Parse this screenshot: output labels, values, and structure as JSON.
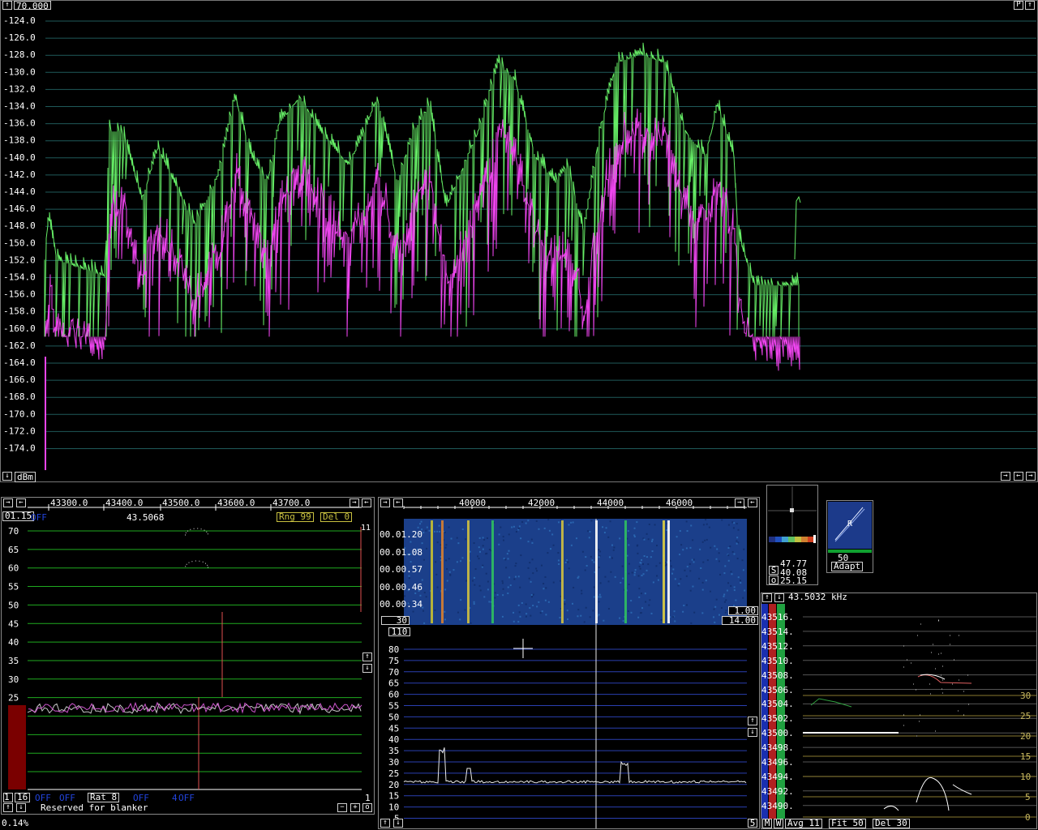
{
  "top_bar": {
    "frequency_field": "70.000",
    "p_button": "P"
  },
  "main_spectrum": {
    "unit_label": "dBm",
    "y_ticks": [
      "-124.0",
      "-126.0",
      "-128.0",
      "-130.0",
      "-132.0",
      "-134.0",
      "-136.0",
      "-138.0",
      "-140.0",
      "-142.0",
      "-144.0",
      "-146.0",
      "-148.0",
      "-150.0",
      "-152.0",
      "-154.0",
      "-156.0",
      "-158.0",
      "-160.0",
      "-162.0",
      "-164.0",
      "-166.0",
      "-168.0",
      "-170.0",
      "-172.0",
      "-174.0"
    ],
    "trace_colors": {
      "peak": "#66ee66",
      "average": "#ee44ee",
      "grid": "#1f5a5a"
    }
  },
  "left_panel": {
    "freq_ticks": [
      "43300.0",
      "43400.0",
      "43500.0",
      "43600.0",
      "43700.0"
    ],
    "time_field": "01.15",
    "off_a": "OFF",
    "off_b": "OFF",
    "center_freq": "43.5068",
    "rng_label": "Rng 99",
    "del_label": "Del  0",
    "marker_top": "11",
    "y_ticks": [
      "70",
      "65",
      "60",
      "55",
      "50",
      "45",
      "40",
      "35",
      "30",
      "25",
      "20",
      "15",
      "10",
      "5"
    ],
    "bottom_num": "16",
    "off_c": "OFF",
    "off_d": "OFF",
    "rat_label": "Rat  8",
    "off_e": "OFF",
    "off_f": "OFF",
    "digit_4": "4",
    "right_num": "1",
    "status_text": "Reserved for blanker",
    "zero_label": "0",
    "percent": "0.14%"
  },
  "middle_panel": {
    "freq_ticks": [
      "40000",
      "42000",
      "44000",
      "46000"
    ],
    "waterfall_times": [
      "00.01.20",
      "00.01.08",
      "00.00.57",
      "00.00.46",
      "00.00.34"
    ],
    "field_30": "30",
    "field_110": "110",
    "field_1_00": "1.00",
    "field_14_00": "14.00",
    "y_ticks": [
      "80",
      "75",
      "70",
      "65",
      "60",
      "55",
      "50",
      "45",
      "40",
      "35",
      "30",
      "25",
      "20",
      "15",
      "10",
      "5"
    ],
    "field_5": "5"
  },
  "right_top": {
    "s_label": "S",
    "o_label": "o",
    "value_1": "47.77",
    "value_2": "40.08",
    "value_3": "25.15",
    "r_label": "R",
    "knob_value": "50",
    "adapt_button": "Adapt"
  },
  "right_panel": {
    "header_freq": "43.5032 kHz",
    "y_ticks": [
      "43516.",
      "43514.",
      "43512.",
      "43510.",
      "43508.",
      "43506.",
      "43504.",
      "43502.",
      "43500.",
      "43498.",
      "43496.",
      "43494.",
      "43492.",
      "43490."
    ],
    "right_ticks": [
      "30",
      "25",
      "20",
      "15",
      "10",
      "5",
      "0"
    ],
    "m_btn": "M",
    "w_btn": "W",
    "avg_label": "Avg 11",
    "fit_label": "Fit 50",
    "del_label": "Del 30"
  }
}
